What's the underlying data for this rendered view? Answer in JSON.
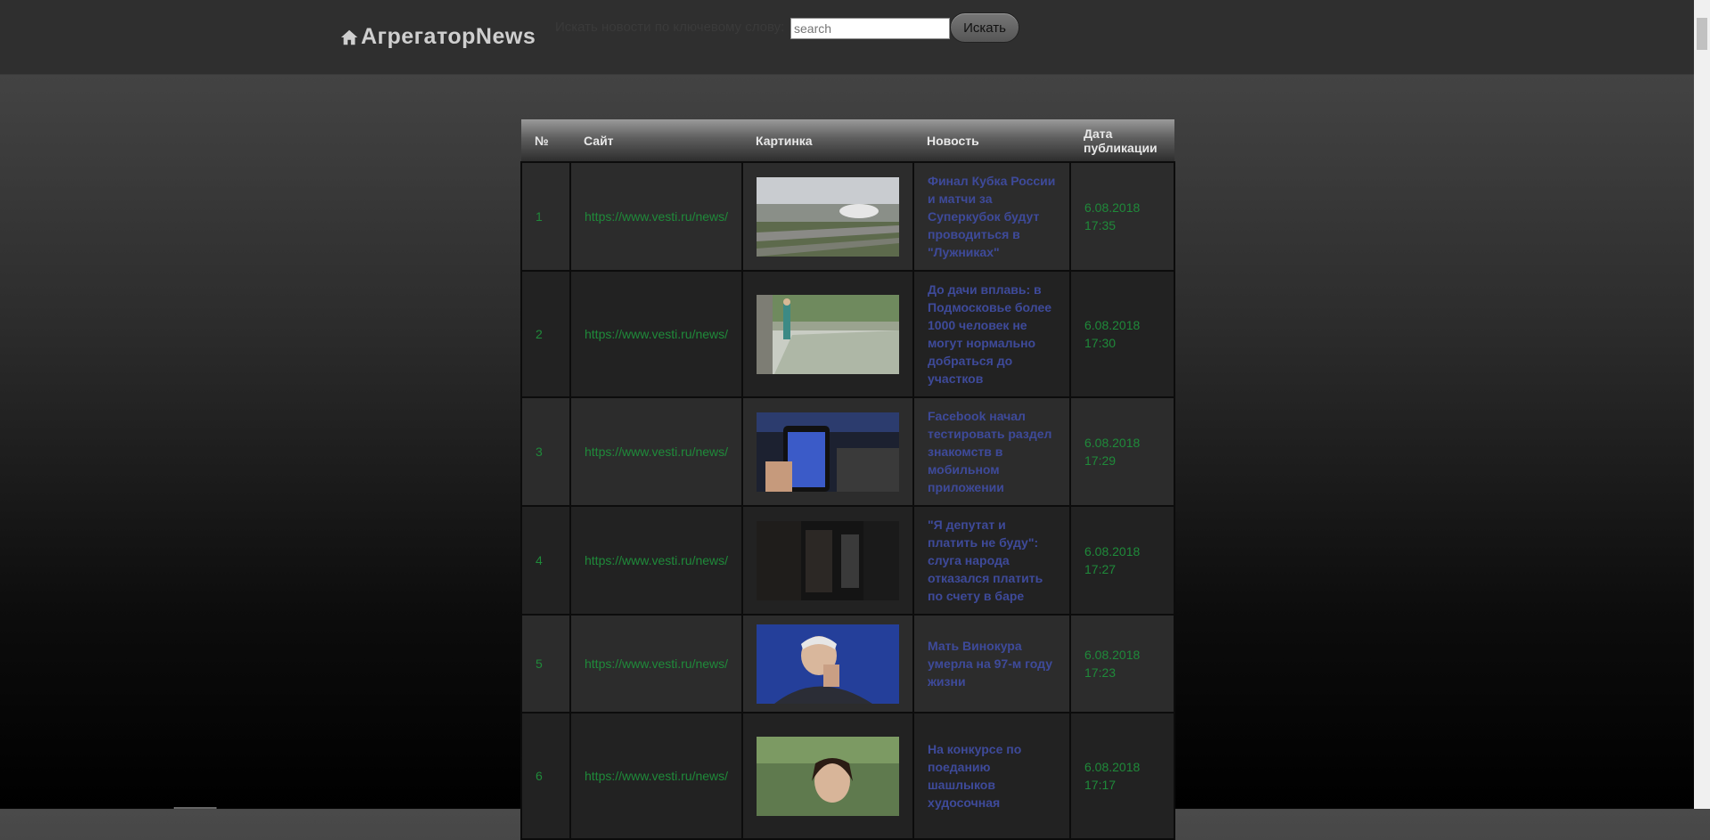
{
  "header": {
    "brand": "АгрегаторNews",
    "tagline": "Искать новости по ключевому слову:",
    "search_placeholder": "search",
    "search_button": "Искать"
  },
  "table": {
    "columns": [
      "№",
      "Сайт",
      "Картинка",
      "Новость",
      "Дата публикации"
    ],
    "rows": [
      {
        "num": "1",
        "site": "https://www.vesti.ru/news/",
        "title": "Финал Кубка России и матчи за Суперкубок будут проводиться в \"Лужниках\"",
        "date": "6.08.2018 17:35",
        "image": "stadium-aerial-photo"
      },
      {
        "num": "2",
        "site": "https://www.vesti.ru/news/",
        "title": "До дачи вплавь: в Подмосковье более 1000 человек не могут нормально добраться до участков",
        "date": "6.08.2018 17:30",
        "image": "flooded-road-photo"
      },
      {
        "num": "3",
        "site": "https://www.vesti.ru/news/",
        "title": "Facebook начал тестировать раздел знакомств в мобильном приложении",
        "date": "6.08.2018 17:29",
        "image": "phone-facebook-photo"
      },
      {
        "num": "4",
        "site": "https://www.vesti.ru/news/",
        "title": "\"Я депутат и платить не буду\": слуга народа отказался платить по счету в баре",
        "date": "6.08.2018 17:27",
        "image": "bar-interior-photo"
      },
      {
        "num": "5",
        "site": "https://www.vesti.ru/news/",
        "title": "Мать Винокура умерла на 97-м году жизни",
        "date": "6.08.2018 17:23",
        "image": "man-portrait-photo"
      },
      {
        "num": "6",
        "site": "https://www.vesti.ru/news/",
        "title": "На конкурсе по поеданию шашлыков худосочная",
        "date": "6.08.2018 17:17",
        "image": "woman-outdoor-photo"
      }
    ]
  },
  "colors": {
    "site_link": "#1f8a3a",
    "news_link": "#3e4a9a",
    "header_bg": "#2f2f2f"
  }
}
